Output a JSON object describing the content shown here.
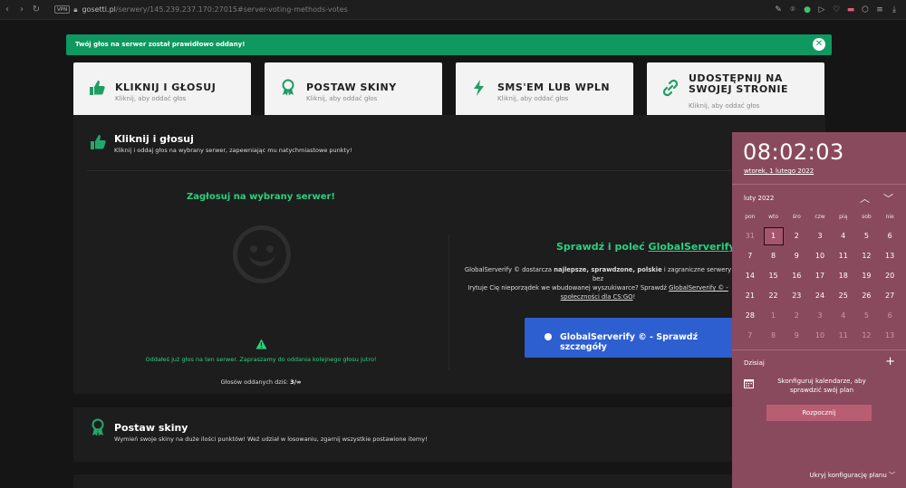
{
  "browser": {
    "url_host": "gosetti.pl",
    "url_path": "/serwery/145.239.237.170:27015#server-voting-methods-votes",
    "vpn_label": "VPN",
    "nav": [
      "‹",
      "›",
      "↻",
      "⊞"
    ],
    "extensions": [
      "✎",
      "⌾",
      "●",
      "▷",
      "♡",
      "▬",
      "⬡",
      "≡",
      "⤓"
    ]
  },
  "toast": {
    "message": "Twój głos na serwer został prawidłowo oddany!",
    "close_icon": "✕"
  },
  "cards": [
    {
      "title": "KLIKNIJ I GŁOSUJ",
      "subtitle": "Kliknij, aby oddać głos",
      "icon": "thumbs-up-icon"
    },
    {
      "title": "POSTAW SKINY",
      "subtitle": "Kliknij, aby oddać głos",
      "icon": "award-icon"
    },
    {
      "title": "SMS'EM LUB WPLN",
      "subtitle": "Kliknij, aby oddać głos",
      "icon": "bolt-icon"
    },
    {
      "title_line1": "UDOSTĘPNIJ NA",
      "title_line2": "SWOJEJ STRONIE",
      "subtitle": "Kliknij, aby oddać głos",
      "icon": "link-icon"
    }
  ],
  "vote_section": {
    "title": "Kliknij i głosuj",
    "subtitle": "Kliknij i oddaj głos na wybrany serwer, zapewniając mu natychmiastowe punkty!",
    "heading": "Zagłosuj na wybrany serwer!",
    "already_voted": "Oddałeś już głos na ten serwer. Zapraszamy do oddania kolejnego głosu jutro!",
    "votes_today_label": "Głosów oddanych dziś:",
    "votes_today_value": "3/∞"
  },
  "globalserverify": {
    "title_prefix": "Sprawdź i poleć",
    "title_link": "GlobalServerify ©",
    "desc_1": "GlobalServerify © dostarcza",
    "desc_bold": "najlepsze, sprawdzone, polskie",
    "desc_2": "i zagraniczne serwery bez",
    "desc_3": "Irytuje Cię nieporządek we wbudowanej wyszukiwarce? Sprawdź",
    "desc_link1": "GlobalServerify © -",
    "desc_link2": "społeczności dla CS:GO",
    "desc_end": "!",
    "button_label": "GlobalServerify © - Sprawdź szczegóły"
  },
  "skins_section": {
    "title": "Postaw skiny",
    "subtitle": "Wymień swoje skiny na duże ilości punktów! Weź udział w losowaniu, zgarnij wszystkie postawione itemy!"
  },
  "calendar": {
    "time": "08:02:03",
    "date": "wtorek, 1 lutego 2022",
    "month": "luty 2022",
    "weekdays": [
      "pon",
      "wto",
      "śro",
      "czw",
      "pią",
      "sob",
      "nie"
    ],
    "days": [
      [
        "31",
        "1",
        "2",
        "3",
        "4",
        "5",
        "6"
      ],
      [
        "7",
        "8",
        "9",
        "10",
        "11",
        "12",
        "13"
      ],
      [
        "14",
        "15",
        "16",
        "17",
        "18",
        "19",
        "20"
      ],
      [
        "21",
        "22",
        "23",
        "24",
        "25",
        "26",
        "27"
      ],
      [
        "28",
        "1",
        "2",
        "3",
        "4",
        "5",
        "6"
      ],
      [
        "7",
        "8",
        "9",
        "10",
        "11",
        "12",
        "13"
      ]
    ],
    "today_label": "Dzisiaj",
    "configure_text": "Skonfiguruj kalendarze, aby sprawdzić swój plan",
    "start_button": "Rozpocznij",
    "hide_link": "Ukryj konfigurację planu",
    "accent": "#8a4a5e"
  },
  "colors": {
    "accent_green": "#2bd17e",
    "toast_green": "#0f9860",
    "button_blue": "#2e5fd1"
  }
}
